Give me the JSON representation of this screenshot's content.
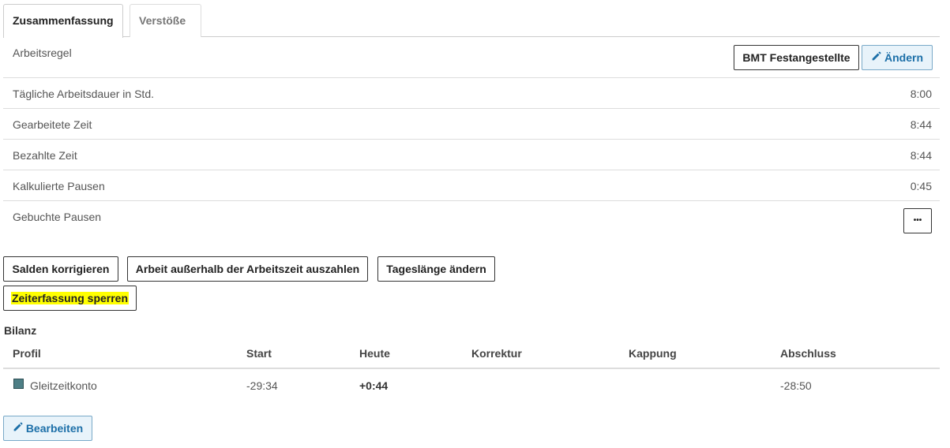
{
  "tabs": [
    {
      "label": "Zusammenfassung",
      "active": true
    },
    {
      "label": "Verstöße",
      "active": false
    }
  ],
  "summary": {
    "work_rule_label": "Arbeitsregel",
    "work_rule_value": "BMT Festangestellte",
    "change_label": "Ändern",
    "rows": [
      {
        "label": "Tägliche Arbeitsdauer in Std.",
        "value": "8:00"
      },
      {
        "label": "Gearbeitete Zeit",
        "value": "8:44"
      },
      {
        "label": "Bezahlte Zeit",
        "value": "8:44"
      },
      {
        "label": "Kalkulierte Pausen",
        "value": "0:45"
      },
      {
        "label": "Gebuchte Pausen",
        "value": ""
      }
    ],
    "more_label": "•••"
  },
  "actions": {
    "correct_balances": "Salden korrigieren",
    "pay_out": "Arbeit außerhalb der Arbeitszeit auszahlen",
    "change_day_length": "Tageslänge ändern",
    "lock_time_tracking": "Zeiterfassung sperren"
  },
  "balance": {
    "title": "Bilanz",
    "columns": [
      "Profil",
      "Start",
      "Heute",
      "Korrektur",
      "Kappung",
      "Abschluss"
    ],
    "rows": [
      {
        "profile": "Gleitzeitkonto",
        "start": "-29:34",
        "today": "+0:44",
        "correction": "",
        "capping": "",
        "closing": "-28:50",
        "color": "#4e7f86"
      }
    ],
    "edit_label": "Bearbeiten"
  },
  "icons": {
    "edit": "pencil-icon",
    "more": "ellipsis-icon",
    "profile": "color-swatch"
  },
  "colors": {
    "accent_blue": "#1c6fa8",
    "highlight": "#ffff00"
  }
}
